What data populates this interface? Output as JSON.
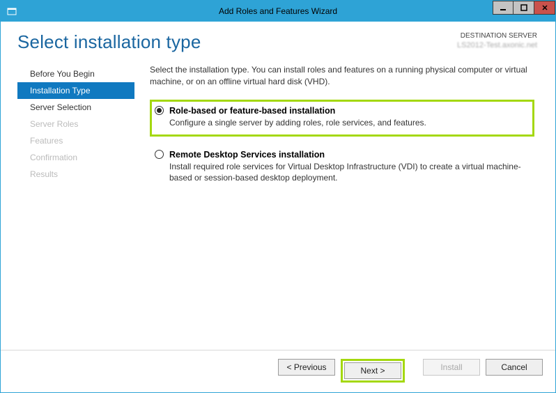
{
  "window": {
    "title": "Add Roles and Features Wizard"
  },
  "header": {
    "page_title": "Select installation type",
    "destination_label": "DESTINATION SERVER",
    "destination_name": "LS2012-Test.axonic.net"
  },
  "sidebar": {
    "items": [
      {
        "label": "Before You Begin",
        "state": "normal"
      },
      {
        "label": "Installation Type",
        "state": "active"
      },
      {
        "label": "Server Selection",
        "state": "normal"
      },
      {
        "label": "Server Roles",
        "state": "disabled"
      },
      {
        "label": "Features",
        "state": "disabled"
      },
      {
        "label": "Confirmation",
        "state": "disabled"
      },
      {
        "label": "Results",
        "state": "disabled"
      }
    ]
  },
  "content": {
    "intro": "Select the installation type. You can install roles and features on a running physical computer or virtual machine, or on an offline virtual hard disk (VHD).",
    "options": [
      {
        "title": "Role-based or feature-based installation",
        "desc": "Configure a single server by adding roles, role services, and features.",
        "checked": true,
        "highlighted": true
      },
      {
        "title": "Remote Desktop Services installation",
        "desc": "Install required role services for Virtual Desktop Infrastructure (VDI) to create a virtual machine-based or session-based desktop deployment.",
        "checked": false,
        "highlighted": false
      }
    ]
  },
  "footer": {
    "previous": "< Previous",
    "next": "Next >",
    "install": "Install",
    "cancel": "Cancel"
  }
}
